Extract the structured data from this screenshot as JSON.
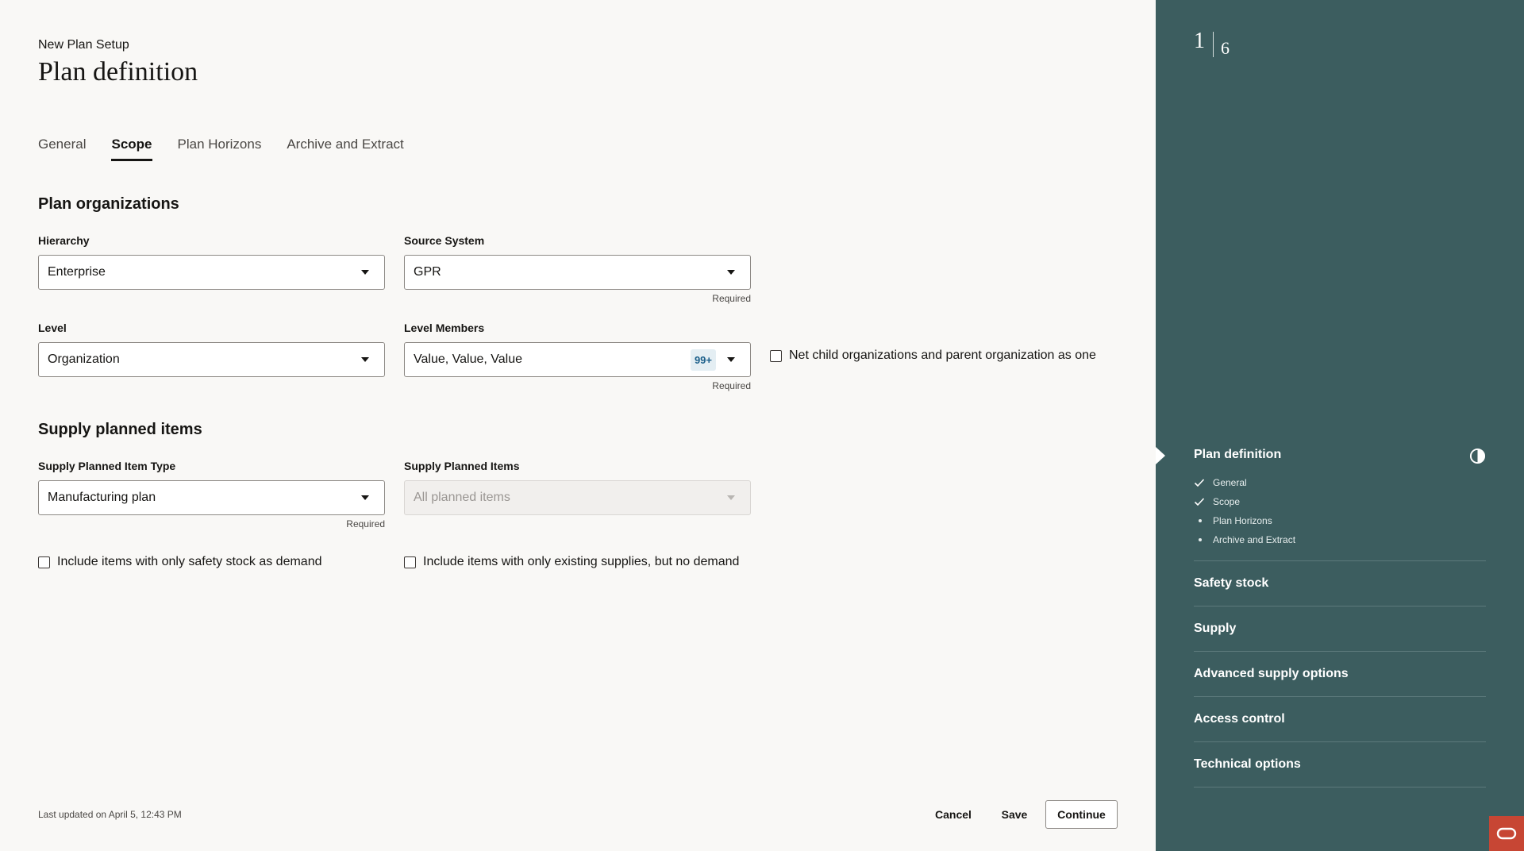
{
  "header": {
    "subtitle": "New Plan Setup",
    "title": "Plan definition"
  },
  "tabs": [
    {
      "label": "General"
    },
    {
      "label": "Scope"
    },
    {
      "label": "Plan Horizons"
    },
    {
      "label": "Archive and Extract"
    }
  ],
  "active_tab": "Scope",
  "plan_organizations": {
    "title": "Plan organizations",
    "hierarchy": {
      "label": "Hierarchy",
      "value": "Enterprise"
    },
    "source_system": {
      "label": "Source System",
      "value": "GPR",
      "hint": "Required"
    },
    "level": {
      "label": "Level",
      "value": "Organization"
    },
    "level_members": {
      "label": "Level Members",
      "value": "Value, Value, Value",
      "badge": "99+",
      "hint": "Required"
    },
    "net_child_checkbox": {
      "label": "Net child organizations and parent organization as one",
      "checked": false
    }
  },
  "supply_planned_items": {
    "title": "Supply planned items",
    "item_type": {
      "label": "Supply Planned Item Type",
      "value": "Manufacturing plan",
      "hint": "Required"
    },
    "items": {
      "label": "Supply Planned Items",
      "placeholder": "All planned items",
      "disabled": true
    },
    "safety_stock_checkbox": {
      "label": "Include items with only safety stock as demand",
      "checked": false
    },
    "existing_supplies_checkbox": {
      "label": "Include items with only existing supplies, but no demand",
      "checked": false
    }
  },
  "footer": {
    "last_updated": "Last updated on April 5, 12:43 PM",
    "cancel": "Cancel",
    "save": "Save",
    "continue": "Continue"
  },
  "side_panel": {
    "progress_current": "1",
    "progress_total": "6",
    "steps": [
      {
        "title": "Plan definition",
        "icon": "contrast-icon",
        "sub_items": [
          {
            "label": "General",
            "status": "done"
          },
          {
            "label": "Scope",
            "status": "done"
          },
          {
            "label": "Plan Horizons",
            "status": "pending"
          },
          {
            "label": "Archive and Extract",
            "status": "pending"
          }
        ]
      },
      {
        "title": "Safety stock"
      },
      {
        "title": "Supply"
      },
      {
        "title": "Advanced supply options"
      },
      {
        "title": "Access control"
      },
      {
        "title": "Technical options"
      }
    ]
  },
  "colors": {
    "side_panel_bg": "#3c5d5f",
    "accent_red": "#c74634",
    "badge_text": "#1b5f8a"
  }
}
